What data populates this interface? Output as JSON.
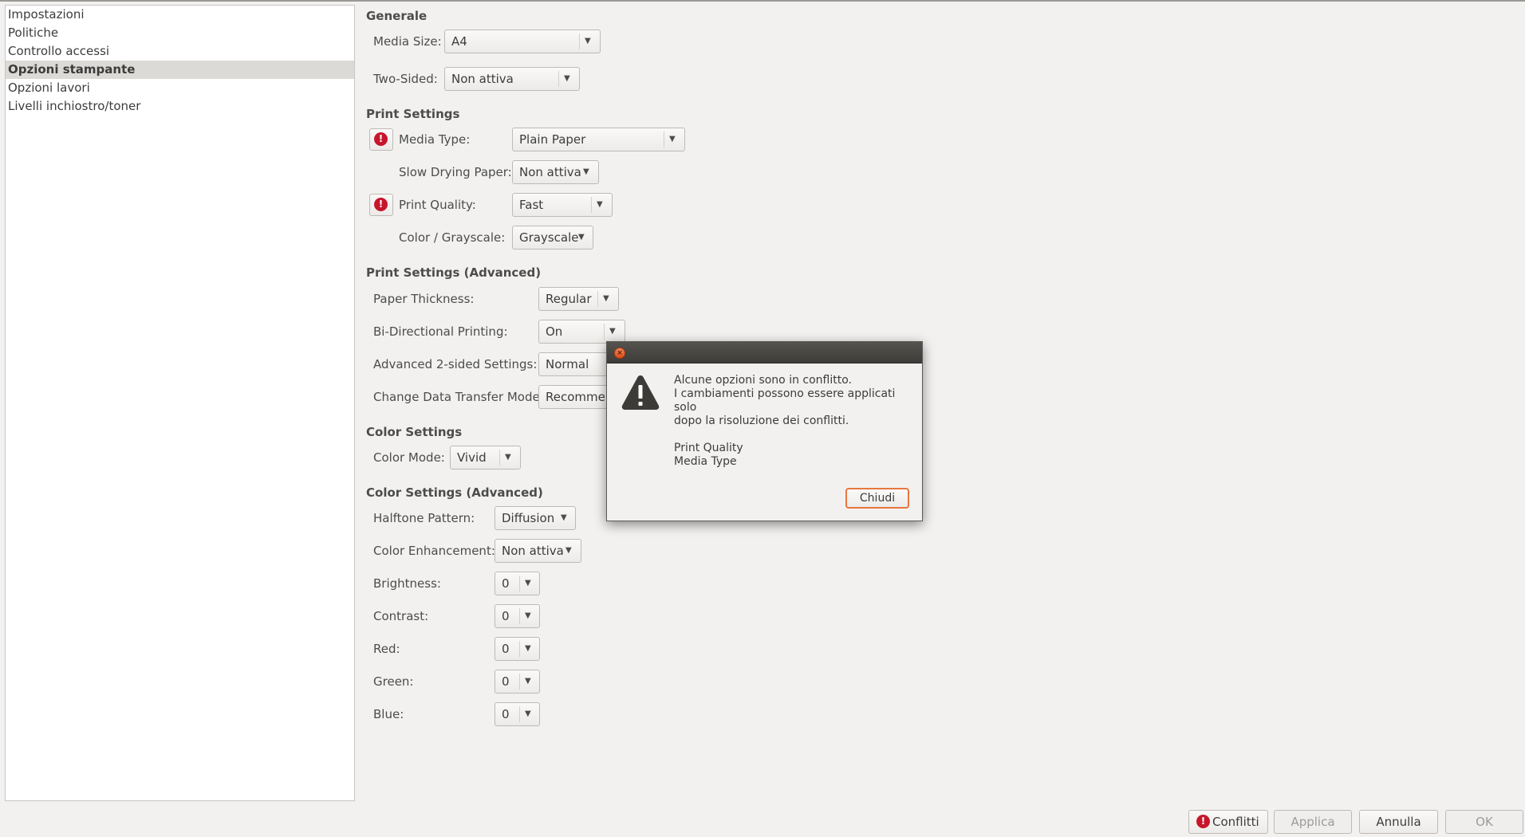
{
  "sidebar": {
    "items": [
      {
        "label": "Impostazioni"
      },
      {
        "label": "Politiche"
      },
      {
        "label": "Controllo accessi"
      },
      {
        "label": "Opzioni stampante",
        "selected": true
      },
      {
        "label": "Opzioni lavori"
      },
      {
        "label": "Livelli inchiostro/toner"
      }
    ]
  },
  "generale": {
    "title": "Generale",
    "media_size": {
      "label": "Media Size:",
      "value": "A4"
    },
    "two_sided": {
      "label": "Two-Sided:",
      "value": "Non attiva"
    }
  },
  "print_settings": {
    "title": "Print Settings",
    "media_type": {
      "label": "Media Type:",
      "value": "Plain Paper"
    },
    "slow_drying": {
      "label": "Slow Drying Paper:",
      "value": "Non attiva"
    },
    "print_quality": {
      "label": "Print Quality:",
      "value": "Fast"
    },
    "color_grayscale": {
      "label": "Color / Grayscale:",
      "value": "Grayscale"
    }
  },
  "print_advanced": {
    "title": "Print Settings (Advanced)",
    "paper_thickness": {
      "label": "Paper Thickness:",
      "value": "Regular"
    },
    "bidirectional": {
      "label": "Bi-Directional Printing:",
      "value": "On"
    },
    "adv_2sided": {
      "label": "Advanced 2-sided Settings:",
      "value": "Normal"
    },
    "data_transfer": {
      "label": "Change Data Transfer Mode:",
      "value": "Recommen"
    }
  },
  "color_settings": {
    "title": "Color Settings",
    "color_mode": {
      "label": "Color Mode:",
      "value": "Vivid"
    }
  },
  "color_advanced": {
    "title": "Color Settings (Advanced)",
    "halftone": {
      "label": "Halftone Pattern:",
      "value": "Diffusion"
    },
    "enhancement": {
      "label": "Color Enhancement:",
      "value": "Non attiva"
    },
    "brightness": {
      "label": "Brightness:",
      "value": "0"
    },
    "contrast": {
      "label": "Contrast:",
      "value": "0"
    },
    "red": {
      "label": "Red:",
      "value": "0"
    },
    "green": {
      "label": "Green:",
      "value": "0"
    },
    "blue": {
      "label": "Blue:",
      "value": "0"
    }
  },
  "dialog": {
    "line1": "Alcune opzioni sono in conflitto.",
    "line2": "I cambiamenti possono essere applicati solo",
    "line3": "dopo la risoluzione dei conflitti.",
    "conflict1": "Print Quality",
    "conflict2": "Media Type",
    "close_label": "Chiudi"
  },
  "buttons": {
    "conflicts": "Conflitti",
    "apply": "Applica",
    "cancel": "Annulla",
    "ok": "OK"
  },
  "icons": {
    "warning": "exclamation-icon",
    "dialog": "warning-triangle-icon",
    "combo": "chevron-down-icon",
    "close": "close-icon"
  },
  "colors": {
    "conflict_red": "#c7162b",
    "focus_orange": "#e9763f",
    "titlebar": "#3d3c38"
  }
}
